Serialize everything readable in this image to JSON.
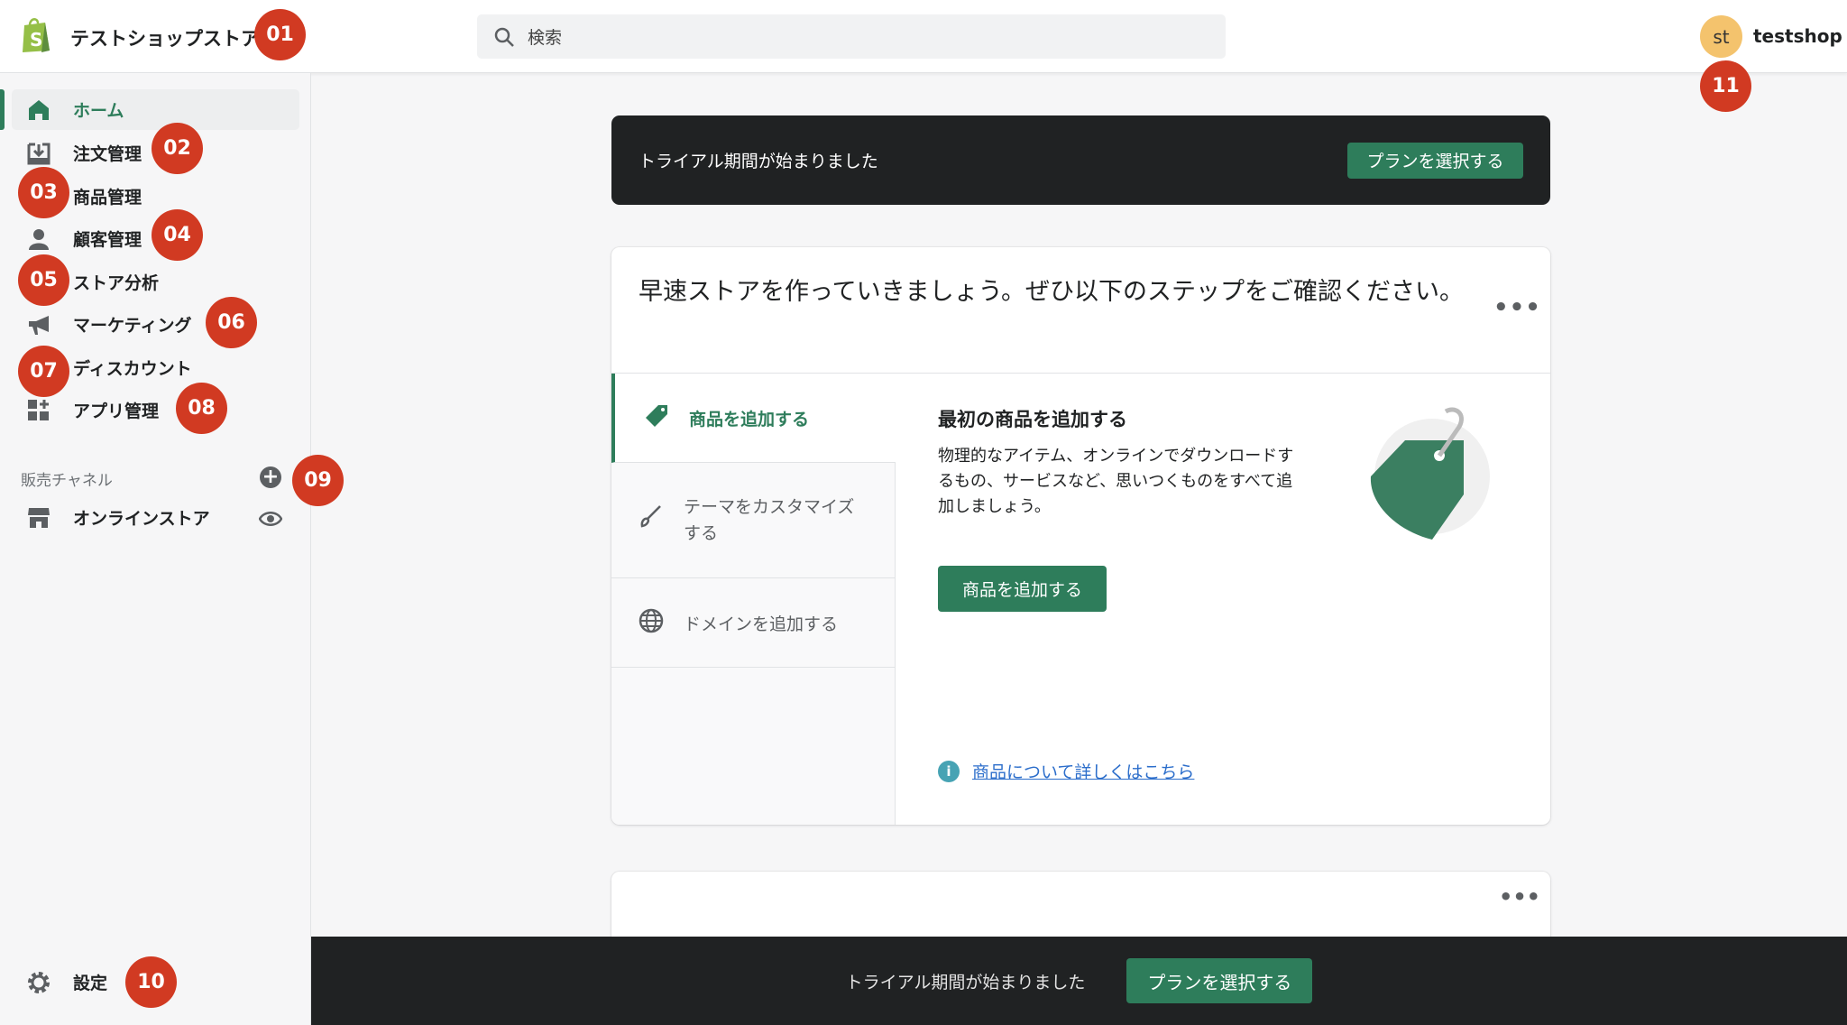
{
  "header": {
    "store_name": "テストショップストア",
    "search_placeholder": "検索",
    "avatar_initials": "st",
    "username": "testshop"
  },
  "sidebar": {
    "items": [
      {
        "label": "ホーム",
        "icon": "home-icon"
      },
      {
        "label": "注文管理",
        "icon": "orders-icon"
      },
      {
        "label": "商品管理",
        "icon": "tag-icon"
      },
      {
        "label": "顧客管理",
        "icon": "customer-icon"
      },
      {
        "label": "ストア分析",
        "icon": "analytics-icon"
      },
      {
        "label": "マーケティング",
        "icon": "megaphone-icon"
      },
      {
        "label": "ディスカウント",
        "icon": "discount-icon"
      },
      {
        "label": "アプリ管理",
        "icon": "apps-icon"
      }
    ],
    "channels_label": "販売チャネル",
    "online_store": "オンラインストア",
    "settings": "設定"
  },
  "badges": [
    "01",
    "02",
    "03",
    "04",
    "05",
    "06",
    "07",
    "08",
    "09",
    "10",
    "11"
  ],
  "banner": {
    "text": "トライアル期間が始まりました",
    "button": "プランを選択する"
  },
  "setup": {
    "title": "早速ストアを作っていきましょう。ぜひ以下のステップをご確認ください。",
    "tabs": [
      "商品を追加する",
      "テーマをカスタマイズする",
      "ドメインを追加する"
    ],
    "content_title": "最初の商品を追加する",
    "content_text": "物理的なアイテム、オンラインでダウンロードするもの、サービスなど、思いつくものをすべて追加しましょう。",
    "button": "商品を追加する",
    "link": "商品について詳しくはこちら"
  },
  "bottom_bar": {
    "text": "トライアル期間が始まりました",
    "button": "プランを選択する"
  },
  "colors": {
    "accent": "#2e7d5b",
    "badge": "#d13a22"
  }
}
